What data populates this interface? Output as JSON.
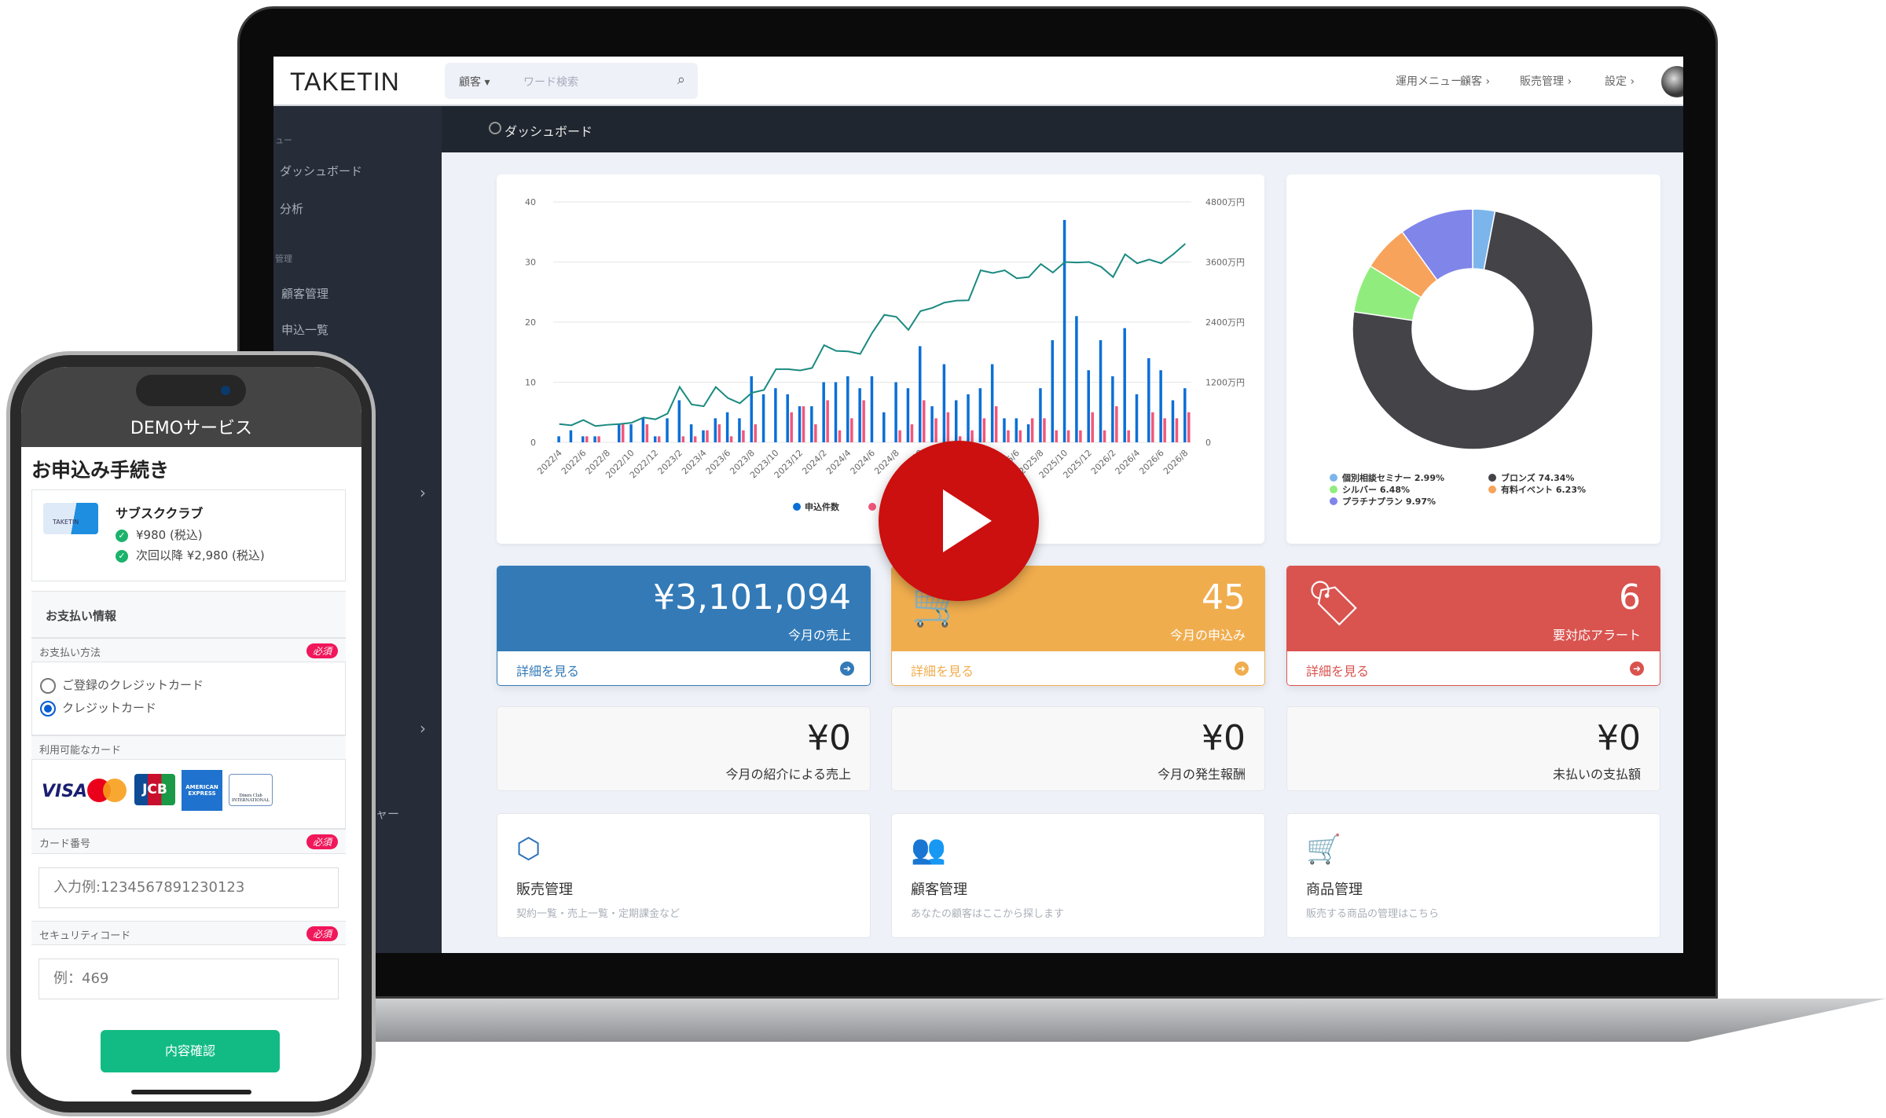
{
  "header": {
    "logo": "TAKETIN",
    "search_select": "顧客",
    "search_placeholder": "ワード検索",
    "nav": [
      "運用メニュー ›",
      "顧客 ›",
      "販売管理 ›",
      "設定 ›"
    ]
  },
  "sidebar": {
    "section1": "ュー",
    "items1": [
      "ダッシュボード",
      "分析"
    ],
    "section2": "管理",
    "items2": [
      "顧客管理",
      "申込一覧"
    ],
    "partial": "ャー",
    "chevron": "›"
  },
  "topbar": {
    "title": "ダッシュボード"
  },
  "chart_data": [
    {
      "type": "bar+line",
      "x": [
        "2022/4",
        "2022/5",
        "2022/6",
        "2022/7",
        "2022/8",
        "2022/9",
        "2022/10",
        "2022/11",
        "2022/12",
        "2023/1",
        "2023/2",
        "2023/3",
        "2023/4",
        "2023/5",
        "2023/6",
        "2023/7",
        "2023/8",
        "2023/9",
        "2023/10",
        "2023/11",
        "2023/12",
        "2024/1",
        "2024/2",
        "2024/3",
        "2024/4",
        "2024/5",
        "2024/6",
        "2024/7",
        "2024/8",
        "2024/9",
        "2024/10",
        "2024/11",
        "2024/12",
        "2025/1",
        "2025/2",
        "2025/3",
        "2025/4",
        "2025/5",
        "2025/6",
        "2025/7",
        "2025/8",
        "2025/9",
        "2025/10",
        "2025/11",
        "2025/12",
        "2026/1",
        "2026/2",
        "2026/3",
        "2026/4",
        "2026/5",
        "2026/6",
        "2026/7",
        "2026/8"
      ],
      "xtick_labels": [
        "2022/4",
        "2022/6",
        "2022/8",
        "2022/10",
        "2022/12",
        "2023/2",
        "2023/4",
        "2023/6",
        "2023/8",
        "2023/10",
        "2023/12",
        "2024/2",
        "2024/4",
        "2024/6",
        "2024/8",
        "2024/10",
        "2024/12",
        "2025/2",
        "2025/4",
        "2025/6",
        "2025/8",
        "2025/10",
        "2025/12",
        "2026/2",
        "2026/4",
        "2026/6",
        "2026/8"
      ],
      "left_axis": {
        "ylim": [
          0,
          40
        ],
        "ticks": [
          "0",
          "10",
          "20",
          "30",
          "40"
        ]
      },
      "right_axis": {
        "ylim": [
          0,
          4800
        ],
        "ticks": [
          "0",
          "1200万円",
          "2400万円",
          "3600万円",
          "4800万円"
        ]
      },
      "grid": true,
      "legend": "bottom",
      "series": [
        {
          "name": "申込件数",
          "kind": "bar",
          "color": "#0a6fd6",
          "values": [
            1,
            2,
            1,
            1,
            0,
            3,
            3,
            4,
            1,
            4,
            7,
            3,
            2,
            4,
            5,
            4,
            11,
            8,
            9,
            8,
            6,
            6,
            10,
            10,
            11,
            9,
            11,
            5,
            10,
            9,
            16,
            6,
            13,
            7,
            8,
            9,
            13,
            4,
            4,
            3,
            9,
            17,
            37,
            21,
            12,
            17,
            11,
            19,
            8,
            14,
            12,
            7,
            9
          ]
        },
        {
          "kind": "bar",
          "color": "#f0577a",
          "values": [
            0,
            0,
            1,
            1,
            0,
            3,
            0,
            3,
            1,
            0,
            1,
            1,
            2,
            3,
            1,
            2,
            3,
            0,
            0,
            5,
            6,
            3,
            7,
            2,
            4,
            7,
            0,
            0,
            2,
            3,
            7,
            4,
            5,
            1,
            2,
            4,
            6,
            2,
            2,
            4,
            4,
            2,
            2,
            2,
            5,
            2,
            6,
            2,
            0,
            5,
            4,
            4,
            5
          ]
        },
        {
          "kind": "line",
          "axis": "right",
          "unit": "万円",
          "color": "#1a8a80",
          "values": [
            365,
            340,
            445,
            325,
            350,
            365,
            390,
            495,
            460,
            575,
            1105,
            755,
            720,
            1105,
            885,
            780,
            990,
            1045,
            1460,
            1460,
            1435,
            1485,
            1940,
            1825,
            1815,
            1765,
            2190,
            2545,
            2505,
            2245,
            2620,
            2685,
            2790,
            2830,
            2835,
            3435,
            3380,
            3435,
            3275,
            3300,
            3560,
            3390,
            3600,
            3590,
            3600,
            3505,
            3300,
            3755,
            3575,
            3650,
            3575,
            3755,
            3965
          ]
        }
      ]
    },
    {
      "type": "pie",
      "donut": true,
      "legend": "bottom",
      "slices": [
        {
          "name": "個別相談セミナー",
          "value": 2.99,
          "label": "個別相談セミナー 2.99%",
          "color": "#7cb5ec"
        },
        {
          "name": "ブロンズ",
          "value": 74.34,
          "label": "ブロンズ 74.34%",
          "color": "#434348"
        },
        {
          "name": "シルバー",
          "value": 6.48,
          "label": "シルバー 6.48%",
          "color": "#90ed7d"
        },
        {
          "name": "有料イベント",
          "value": 6.23,
          "label": "有料イベント 6.23%",
          "color": "#f7a35c"
        },
        {
          "name": "プラチナプラン",
          "value": 9.97,
          "label": "プラチナプラン 9.97%",
          "color": "#8085e9"
        }
      ]
    }
  ],
  "stats": [
    {
      "value": "¥3,101,094",
      "label": "今月の売上",
      "link": "詳細を見る",
      "color": "#337ab7",
      "icon": "none"
    },
    {
      "value": "45",
      "label": "今月の申込み",
      "link": "詳細を見る",
      "color": "#f0ad4e",
      "icon": "cart-icon"
    },
    {
      "value": "6",
      "label": "要対応アラート",
      "link": "詳細を見る",
      "color": "#d9534f",
      "icon": "tags-icon"
    }
  ],
  "summaries": [
    {
      "value": "¥0",
      "label": "今月の紹介による売上"
    },
    {
      "value": "¥0",
      "label": "今月の発生報酬"
    },
    {
      "value": "¥0",
      "label": "未払いの支払額"
    }
  ],
  "links": [
    {
      "title": "販売管理",
      "sub": "契約一覧・売上一覧・定期課金など",
      "icon": "box-icon",
      "color": "#2c72b8"
    },
    {
      "title": "顧客管理",
      "sub": "あなたの顧客はここから探します",
      "icon": "users-icon",
      "color": "#555b66"
    },
    {
      "title": "商品管理",
      "sub": "販売する商品の管理はこちら",
      "icon": "cart-icon",
      "color": "#555b66"
    }
  ],
  "video": {
    "icon": "play-icon",
    "color": "#cc0f0f"
  },
  "phone": {
    "service": "DEMOサービス",
    "title": "お申込み手続き",
    "product": {
      "name": "サブスククラブ",
      "logo": "TAKETIN",
      "price1": "¥980 (税込)",
      "price2": "次回以降 ¥2,980 (税込)"
    },
    "payment_header": "お支払い情報",
    "method_label": "お支払い方法",
    "required": "必須",
    "methods": [
      {
        "label": "ご登録のクレジットカード",
        "selected": false
      },
      {
        "label": "クレジットカード",
        "selected": true
      }
    ],
    "cards_label": "利用可能なカード",
    "cards": [
      "VISA",
      "Mastercard",
      "JCB",
      "AMERICAN EXPRESS",
      "Diners Club INTERNATIONAL"
    ],
    "card_number_label": "カード番号",
    "card_number_placeholder": "入力例:1234567891230123",
    "security_label": "セキュリティコード",
    "security_placeholder": "例：469",
    "submit": "内容確認"
  }
}
